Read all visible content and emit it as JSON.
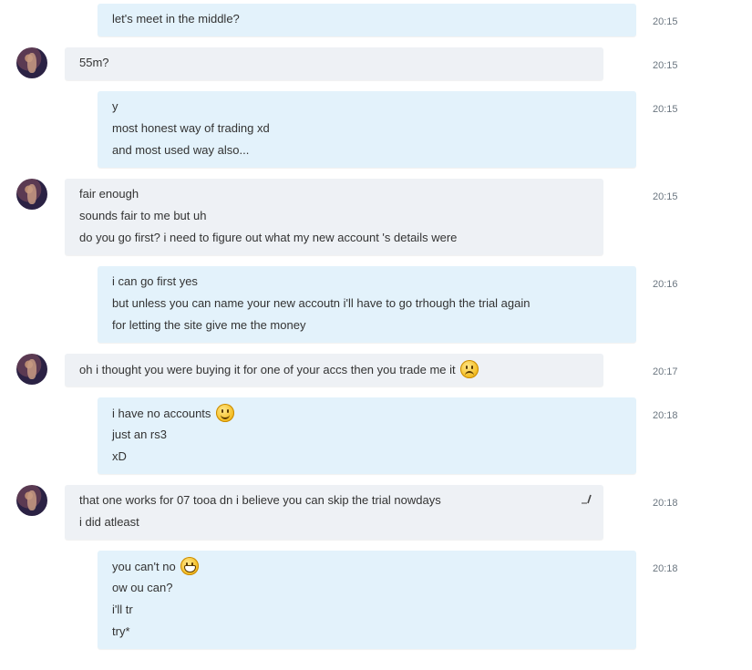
{
  "messages": [
    {
      "direction": "out",
      "time": "20:15",
      "lines": [
        "let's meet in the middle?"
      ]
    },
    {
      "direction": "in",
      "time": "20:15",
      "lines": [
        "55m?"
      ]
    },
    {
      "direction": "out",
      "time": "20:15",
      "lines": [
        "y",
        "most honest way of trading xd",
        "and most used way also..."
      ]
    },
    {
      "direction": "in",
      "time": "20:15",
      "lines": [
        "fair enough",
        "sounds fair to me but uh",
        "do you go first? i need to figure out what my new account 's details were"
      ]
    },
    {
      "direction": "out",
      "time": "20:16",
      "lines": [
        "i can go first yes",
        "but unless you can name your new accoutn i'll have to go trhough the trial again",
        "for letting the site give me the money"
      ]
    },
    {
      "direction": "in",
      "time": "20:17",
      "lines": [
        "oh i thought you were buying it for one of your accs then you trade me it"
      ],
      "emoji": "sad-face-emoji"
    },
    {
      "direction": "out",
      "time": "20:18",
      "lines": [
        "i have no accounts",
        "just an rs3",
        "xD"
      ],
      "emoji": "smile-emoji"
    },
    {
      "direction": "in",
      "time": "20:18",
      "lines": [
        "that one works for 07 tooa dn i believe you can skip the trial nowdays",
        "i did atleast"
      ],
      "edited_icon": "edit-pencil-icon"
    },
    {
      "direction": "out",
      "time": "20:18",
      "lines": [
        "you can't no",
        "ow ou can?",
        "i'll tr",
        "try*"
      ],
      "emoji": "grin-emoji"
    }
  ]
}
